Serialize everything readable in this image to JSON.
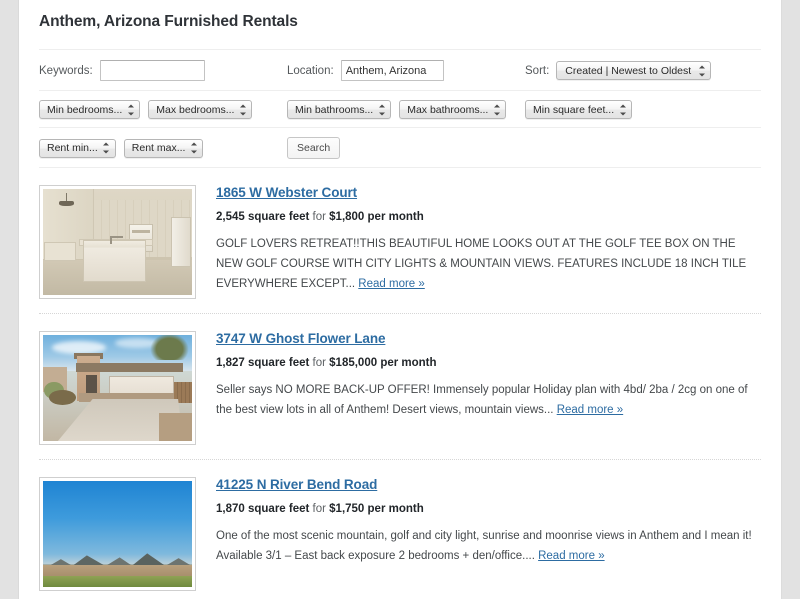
{
  "page": {
    "title": "Anthem, Arizona Furnished Rentals"
  },
  "search": {
    "keywords_label": "Keywords:",
    "keywords_value": "",
    "keywords_placeholder": "",
    "location_label": "Location:",
    "location_value": "Anthem, Arizona",
    "sort_label": "Sort:",
    "sort_value": "Created | Newest to Oldest",
    "min_bedrooms": "Min bedrooms...",
    "max_bedrooms": "Max bedrooms...",
    "min_bathrooms": "Min bathrooms...",
    "max_bathrooms": "Max bathrooms...",
    "min_square_feet": "Min square feet...",
    "rent_min": "Rent min...",
    "rent_max": "Rent max...",
    "search_button": "Search"
  },
  "listings": [
    {
      "title": "1865 W Webster Court",
      "sqft": "2,545 square feet",
      "for": " for ",
      "price": "$1,800 per month",
      "excerpt": "GOLF LOVERS RETREAT!!THIS BEAUTIFUL HOME LOOKS OUT AT THE GOLF TEE BOX ON THE NEW GOLF COURSE WITH CITY LIGHTS & MOUNTAIN VIEWS. FEATURES INCLUDE 18 INCH TILE EVERYWHERE EXCEPT... ",
      "read_more": "Read more »",
      "thumb": "kitchen-interior-photo"
    },
    {
      "title": "3747 W Ghost Flower Lane",
      "sqft": "1,827 square feet",
      "for": " for ",
      "price": "$185,000 per month",
      "excerpt": "Seller says NO MORE BACK-UP OFFER! Immensely popular Holiday plan with 4bd/ 2ba / 2cg on one of the best view lots in all of Anthem! Desert views, mountain views... ",
      "read_more": "Read more »",
      "thumb": "house-exterior-photo"
    },
    {
      "title": "41225 N River Bend Road",
      "sqft": "1,870 square feet",
      "for": " for ",
      "price": "$1,750 per month",
      "excerpt": "One of the most scenic mountain, golf and city light, sunrise and moonrise views in Anthem and I mean it! Available 3/1 – East back exposure 2 bedrooms + den/office.... ",
      "read_more": "Read more »",
      "thumb": "desert-mountain-view-photo"
    }
  ],
  "colors": {
    "link": "#2d6ca2",
    "page_bg": "#e2e2e2",
    "sheet_bg": "#ffffff",
    "title_text": "#2f3338"
  }
}
